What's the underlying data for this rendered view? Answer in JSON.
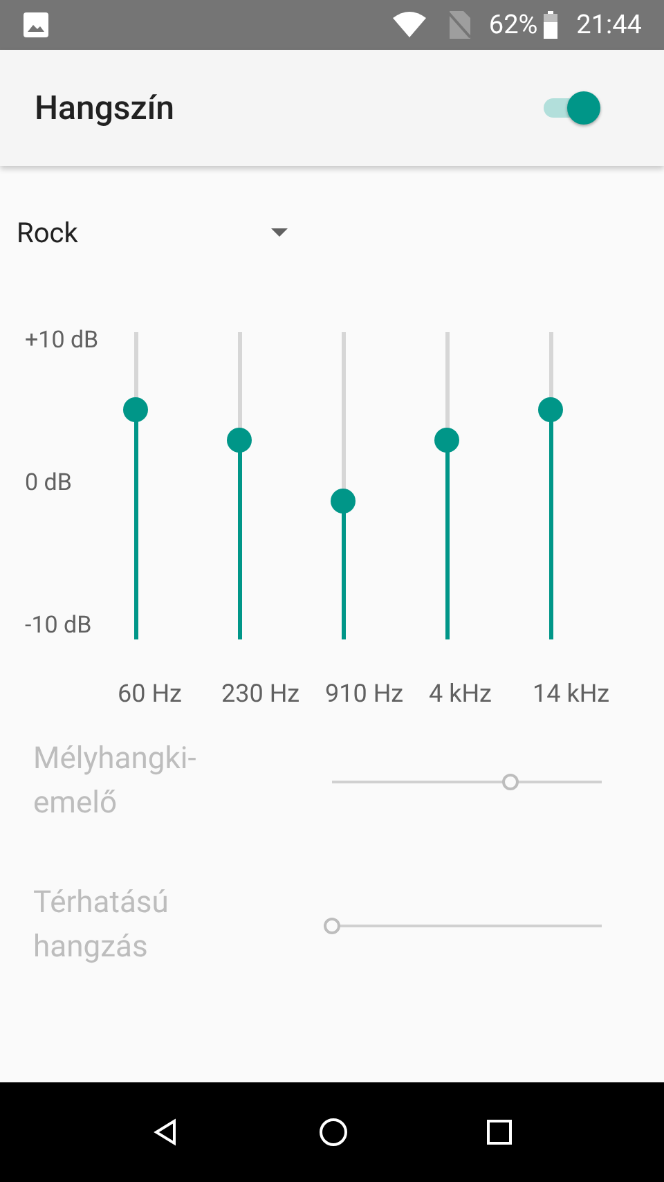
{
  "status_bar": {
    "battery": "62%",
    "time": "21:44"
  },
  "app_bar": {
    "title": "Hangszín",
    "enabled": true
  },
  "preset": {
    "value": "Rock"
  },
  "equalizer": {
    "scale": [
      "+10 dB",
      "0 dB",
      "-10 dB"
    ],
    "bands": [
      {
        "label": "60 Hz",
        "level": 0.75
      },
      {
        "label": "230 Hz",
        "level": 0.65
      },
      {
        "label": "910 Hz",
        "level": 0.45
      },
      {
        "label": "4 kHz",
        "level": 0.65
      },
      {
        "label": "14 kHz",
        "level": 0.75
      }
    ]
  },
  "effects": [
    {
      "label": "Mélyhangki-emelő",
      "level": 0.66,
      "disabled": true
    },
    {
      "label": "Térhatású hangzás",
      "level": 0,
      "disabled": true
    }
  ]
}
